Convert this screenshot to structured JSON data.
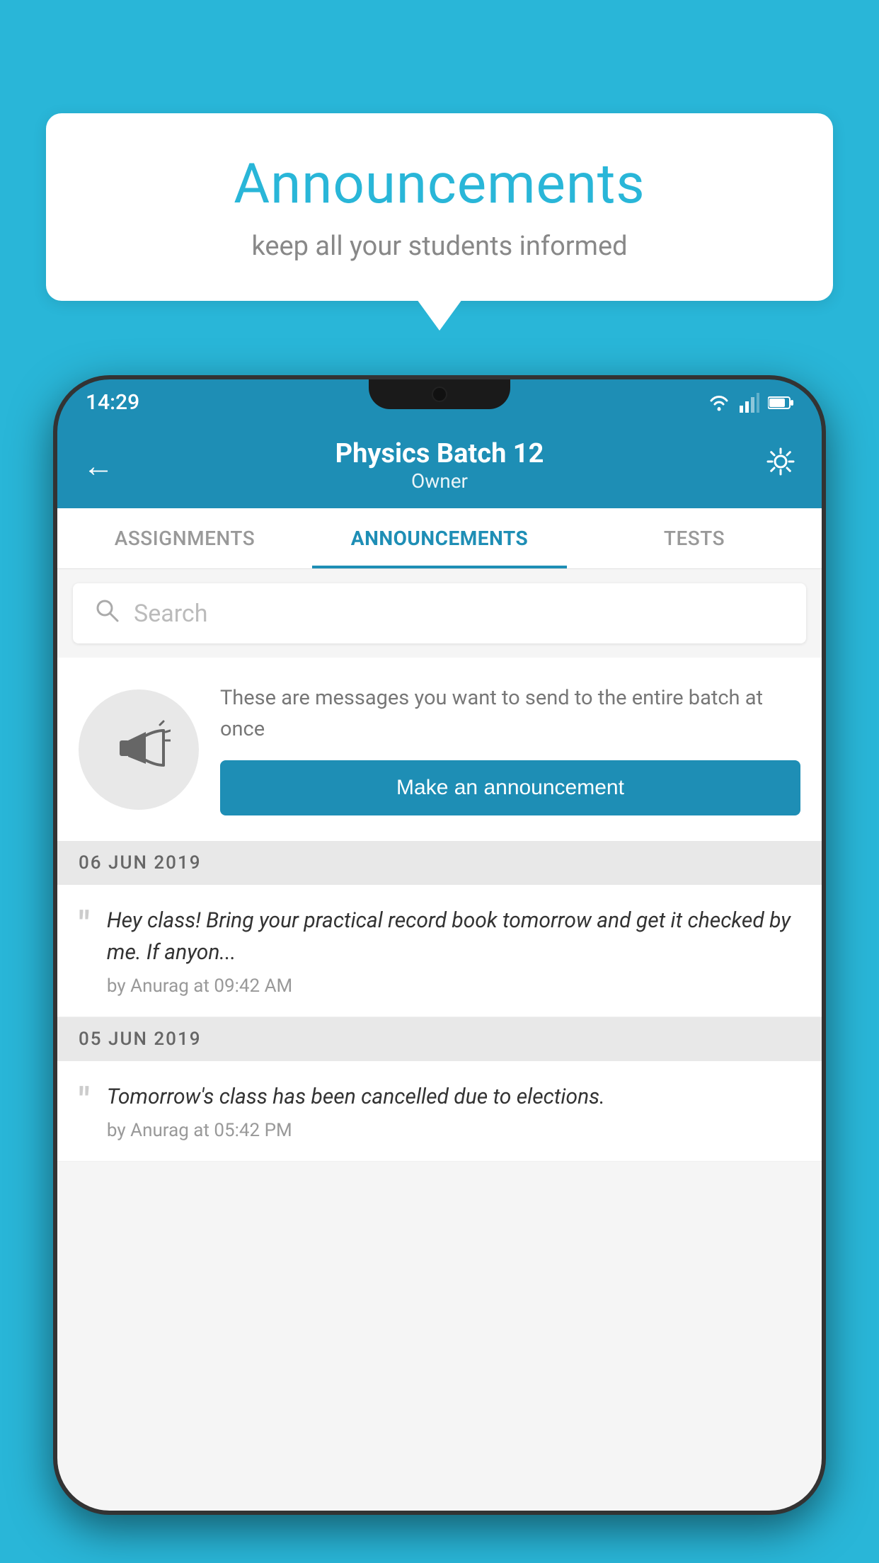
{
  "background_color": "#29b6d8",
  "speech_bubble": {
    "title": "Announcements",
    "subtitle": "keep all your students informed"
  },
  "phone": {
    "status_bar": {
      "time": "14:29"
    },
    "header": {
      "title": "Physics Batch 12",
      "subtitle": "Owner",
      "back_label": "←",
      "gear_label": "⚙"
    },
    "tabs": [
      {
        "label": "ASSIGNMENTS",
        "active": false
      },
      {
        "label": "ANNOUNCEMENTS",
        "active": true
      },
      {
        "label": "TESTS",
        "active": false
      }
    ],
    "search": {
      "placeholder": "Search"
    },
    "promo": {
      "description": "These are messages you want to send to the entire batch at once",
      "button_label": "Make an announcement"
    },
    "announcements": [
      {
        "date": "06  JUN  2019",
        "text": "Hey class! Bring your practical record book tomorrow and get it checked by me. If anyon...",
        "meta": "by Anurag at 09:42 AM"
      },
      {
        "date": "05  JUN  2019",
        "text": "Tomorrow's class has been cancelled due to elections.",
        "meta": "by Anurag at 05:42 PM"
      }
    ]
  }
}
